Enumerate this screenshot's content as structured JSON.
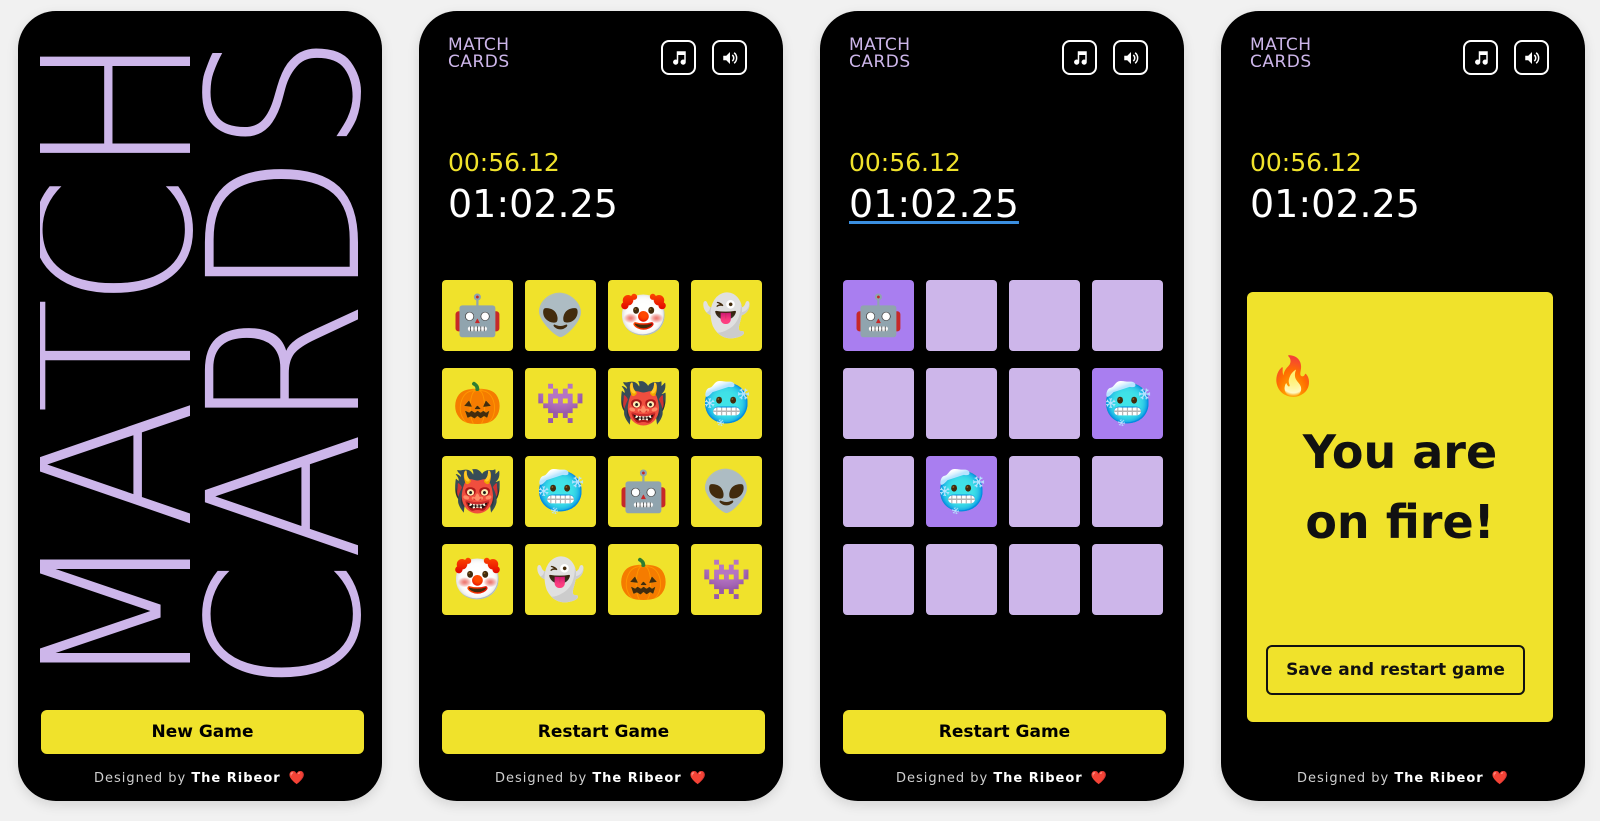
{
  "colors": {
    "background": "#000000",
    "accent_yellow": "#f0e22b",
    "accent_lavender": "#cdb6ea",
    "matched_purple": "#a97ef0",
    "underline_blue": "#3b8fe0"
  },
  "footer": {
    "prefix": "Designed by",
    "author": "The Ribeor",
    "heart": "❤️"
  },
  "splash": {
    "title_line1": "MATCH",
    "title_line2": "CARDS",
    "new_game_label": "New Game"
  },
  "header": {
    "logo_line1": "MATCH",
    "logo_line2": "CARDS",
    "music_icon": "music-note-icon",
    "sound_icon": "speaker-icon"
  },
  "timer": {
    "best": "00:56.12",
    "current": "01:02.25"
  },
  "board_faceup": [
    "🤖",
    "👽",
    "🤡",
    "👻",
    "🎃",
    "👾",
    "👹",
    "🥶",
    "👹",
    "🥶",
    "🤖",
    "👽",
    "🤡",
    "👻",
    "🎃",
    "👾"
  ],
  "board_playing": [
    {
      "state": "matched",
      "emoji": "🤖"
    },
    {
      "state": "hidden",
      "emoji": ""
    },
    {
      "state": "hidden",
      "emoji": ""
    },
    {
      "state": "hidden",
      "emoji": ""
    },
    {
      "state": "hidden",
      "emoji": ""
    },
    {
      "state": "hidden",
      "emoji": ""
    },
    {
      "state": "hidden",
      "emoji": ""
    },
    {
      "state": "matched",
      "emoji": "🥶"
    },
    {
      "state": "hidden",
      "emoji": ""
    },
    {
      "state": "matched",
      "emoji": "🥶"
    },
    {
      "state": "hidden",
      "emoji": ""
    },
    {
      "state": "hidden",
      "emoji": ""
    },
    {
      "state": "hidden",
      "emoji": ""
    },
    {
      "state": "hidden",
      "emoji": ""
    },
    {
      "state": "hidden",
      "emoji": ""
    },
    {
      "state": "hidden",
      "emoji": ""
    }
  ],
  "restart_label": "Restart Game",
  "win": {
    "emoji": "🔥",
    "title_line1": "You are",
    "title_line2": "on fire!",
    "save_restart_label": "Save and restart game"
  }
}
